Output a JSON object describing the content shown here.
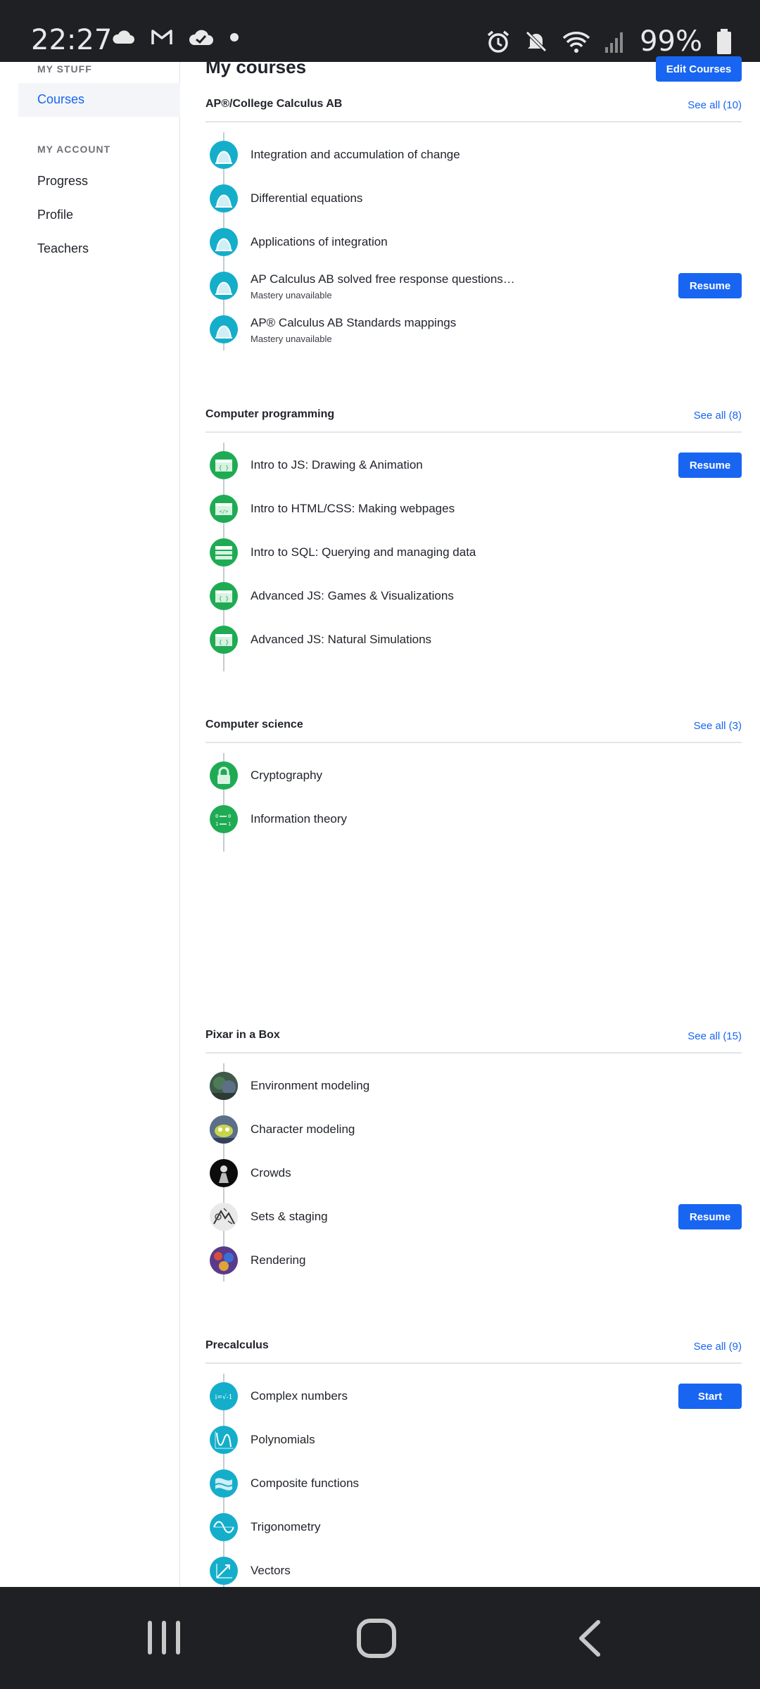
{
  "status_bar": {
    "time": "22:27",
    "battery": "99%",
    "icons": [
      "cloud-icon",
      "gmail-icon",
      "cloud-check-icon",
      "dot-icon",
      "alarm-icon",
      "mute-icon",
      "wifi-icon",
      "signal-icon",
      "battery-icon"
    ]
  },
  "sidebar": {
    "my_stuff_label": "MY STUFF",
    "courses_label": "Courses",
    "my_account_label": "MY ACCOUNT",
    "progress_label": "Progress",
    "profile_label": "Profile",
    "teachers_label": "Teachers"
  },
  "main": {
    "title": "My courses",
    "edit_courses_label": "Edit Courses",
    "courses": [
      {
        "title": "AP®/College Calculus AB",
        "see_all": "See all (10)",
        "units": [
          {
            "title": "Integration and accumulation of change"
          },
          {
            "title": "Differential equations"
          },
          {
            "title": "Applications of integration"
          },
          {
            "title": "AP Calculus AB solved free response questions…",
            "subtitle": "Mastery unavailable",
            "action": "Resume"
          },
          {
            "title": "AP® Calculus AB Standards mappings",
            "subtitle": "Mastery unavailable"
          }
        ]
      },
      {
        "title": "Computer programming",
        "see_all": "See all (8)",
        "units": [
          {
            "title": "Intro to JS: Drawing & Animation",
            "action": "Resume"
          },
          {
            "title": "Intro to HTML/CSS: Making webpages"
          },
          {
            "title": "Intro to SQL: Querying and managing data"
          },
          {
            "title": "Advanced JS: Games & Visualizations"
          },
          {
            "title": "Advanced JS: Natural Simulations"
          }
        ]
      },
      {
        "title": "Computer science",
        "see_all": "See all (3)",
        "units": [
          {
            "title": "Cryptography"
          },
          {
            "title": "Information theory"
          }
        ]
      },
      {
        "title": "Pixar in a Box",
        "see_all": "See all (15)",
        "units": [
          {
            "title": "Environment modeling"
          },
          {
            "title": "Character modeling"
          },
          {
            "title": "Crowds"
          },
          {
            "title": "Sets & staging",
            "action": "Resume"
          },
          {
            "title": "Rendering"
          }
        ]
      },
      {
        "title": "Precalculus",
        "see_all": "See all (9)",
        "units": [
          {
            "title": "Complex numbers",
            "action": "Start"
          },
          {
            "title": "Polynomials"
          },
          {
            "title": "Composite functions"
          },
          {
            "title": "Trigonometry"
          },
          {
            "title": "Vectors"
          }
        ]
      }
    ]
  },
  "colors": {
    "accent": "#1865f2",
    "math_icon": "#14aecb",
    "computing_icon": "#1fab54"
  }
}
